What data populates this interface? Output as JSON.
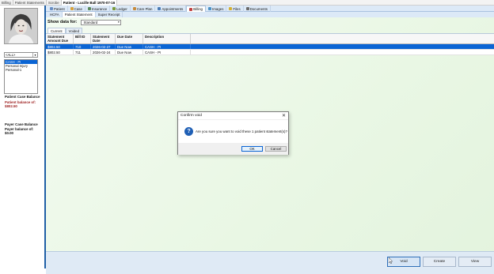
{
  "top_tabs": [
    "Billing",
    "Patient Statements",
    "Scrobe",
    "Patient - Lucille Ball 1970-07-16"
  ],
  "sidebar": {
    "case_filter": "<ALL>",
    "cases": [
      "CASH - PI",
      "Personal Injury",
      "Personal-1"
    ],
    "patient_case_balance_label": "Patient Case Balance",
    "patient_balance_text": "Patient balance of:",
    "patient_balance_value": "$802.50",
    "payer_case_balance_label": "Payer Case Balance",
    "payer_balance_text": "Payer balance of:",
    "payer_balance_value": "$0.00"
  },
  "module_tabs": [
    {
      "label": "Patient",
      "icon": "person-icon",
      "color": "#6a8fc4"
    },
    {
      "label": "Case",
      "icon": "folder-icon",
      "color": "#d9a23a"
    },
    {
      "label": "Insurance",
      "icon": "shield-icon",
      "color": "#5a8a5a"
    },
    {
      "label": "Ledger",
      "icon": "ledger-icon",
      "color": "#7a9a3a"
    },
    {
      "label": "Care Plan",
      "icon": "clipboard-icon",
      "color": "#c78a3a"
    },
    {
      "label": "Appointments",
      "icon": "calendar-icon",
      "color": "#4a7ab5"
    },
    {
      "label": "Billing",
      "icon": "billing-icon",
      "color": "#c04040"
    },
    {
      "label": "Images",
      "icon": "image-icon",
      "color": "#4a90c4"
    },
    {
      "label": "Files",
      "icon": "file-icon",
      "color": "#d4b030"
    },
    {
      "label": "Documents",
      "icon": "document-icon",
      "color": "#6a6a6a"
    }
  ],
  "active_module": "Billing",
  "sub_tabs": [
    "HCFA",
    "Patient Statement",
    "Super Receipt"
  ],
  "active_sub_tab": "Patient Statement",
  "show_data_label": "Show data for:",
  "show_data_value": "Standard",
  "grid_tabs": [
    "Current",
    "Voided"
  ],
  "active_grid_tab": "Current",
  "grid": {
    "columns": [
      "Statement Amount Due",
      "Bill ID",
      "Statement Date",
      "Due Date",
      "Description"
    ],
    "rows": [
      {
        "amount": "$802.50",
        "bill_id": "710",
        "date": "2026-02-27",
        "due": "Due Now",
        "desc": "CASH - PI"
      },
      {
        "amount": "$802.50",
        "bill_id": "711",
        "date": "2026-02-24",
        "due": "Due Now",
        "desc": "CASH - PI"
      }
    ]
  },
  "footer_buttons": {
    "void": "Void",
    "create": "Create",
    "view": "View"
  },
  "dialog": {
    "title": "Confirm void",
    "message": "Are you sure you want to void these 1 patient statement(s)?",
    "ok": "OK",
    "cancel": "Cancel",
    "close": "✕",
    "icon": "?"
  }
}
